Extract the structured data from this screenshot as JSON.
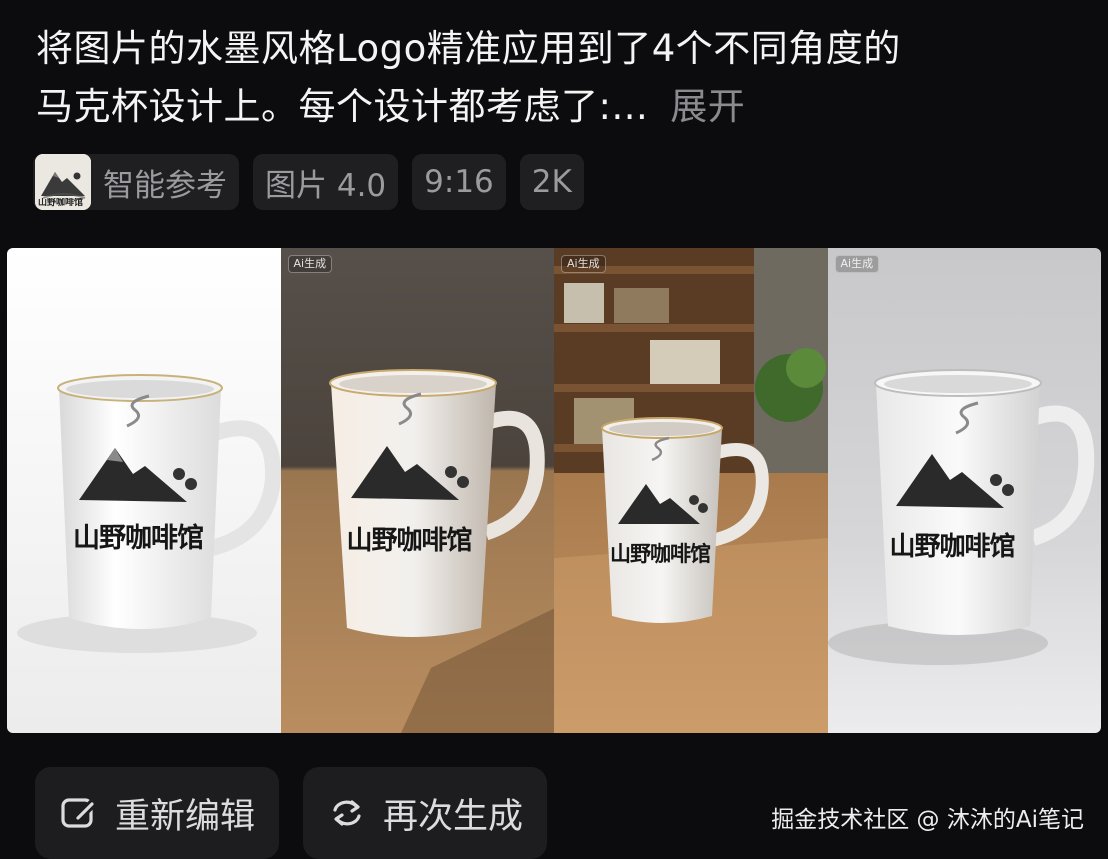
{
  "prompt": {
    "line1": "将图片的水墨风格Logo精准应用到了4个不同角度的",
    "line2": "马克杯设计上。每个设计都考虑了:...",
    "expand_label": "展开"
  },
  "reference_logo_text": "山野咖啡馆",
  "chips": {
    "reference_label": "智能参考",
    "model": "图片 4.0",
    "ratio": "9:16",
    "resolution": "2K"
  },
  "images": {
    "ai_tag": "Ai生成",
    "mug_logo_text": "山野咖啡馆"
  },
  "actions": {
    "edit_label": "重新编辑",
    "regenerate_label": "再次生成"
  },
  "watermark": "掘金技术社区 @ 沐沐的Ai笔记"
}
